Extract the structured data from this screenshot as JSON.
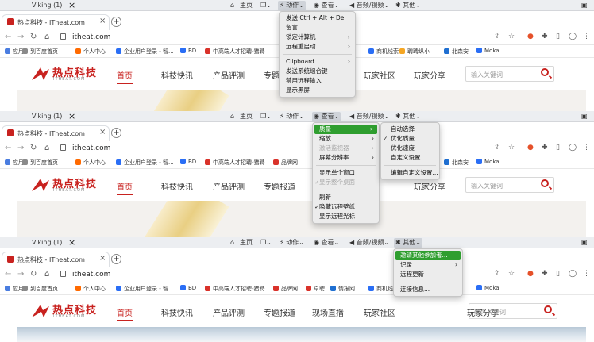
{
  "colors": {
    "accent": "#c8221f",
    "menu_highlight": "#2f9e2f",
    "traffic_red": "#ff5f57",
    "traffic_yellow": "#febc2e",
    "traffic_green": "#28c840"
  },
  "toolbar": {
    "title": "Viking (1)",
    "close_icon": "×",
    "home": "主页",
    "action": "动作",
    "view": "查看",
    "av": "音频/视频",
    "other": "其他"
  },
  "browser": {
    "tab_title": "热点科技 - ITheat.com",
    "tab_close": "×",
    "new_tab": "+",
    "url": "itheat.com"
  },
  "bookmarks": {
    "p1": [
      "应用",
      "到百度首页",
      "个人中心",
      "企业用户登录 - 智...",
      "BD",
      "中高端人才招聘-猎聘",
      "商机线索",
      "聘聘纵小",
      "北森安",
      "Moka"
    ],
    "p2": [
      "应用",
      "到百度首页",
      "个人中心",
      "企业用户登录 - 智...",
      "BD",
      "中高端人才招聘-猎聘",
      "品牌网",
      "北森安",
      "Moka"
    ],
    "p3": [
      "应用",
      "到百度首页",
      "个人中心",
      "企业用户登录 - 智...",
      "BD",
      "中高端人才招聘-猎聘",
      "品牌网",
      "卓聘",
      "情报网",
      "商机线索",
      "Moka"
    ]
  },
  "site": {
    "logo": "热点科技",
    "logo_sub": "ITHEAT.COM",
    "search_placeholder": "输入关键词",
    "nav": [
      "首页",
      "科技快讯",
      "产品评测",
      "专题报道",
      "现场直播",
      "玩家社区",
      "玩家分享"
    ]
  },
  "menus": {
    "action": {
      "items": [
        "发送 Ctrl + Alt + Del",
        "留言",
        "锁定计算机",
        "远程重启动",
        "Clipboard",
        "发送系统组合键",
        "禁用远程输入",
        "显示黑屏"
      ]
    },
    "view": {
      "items": [
        "质量",
        "缩放",
        "激活监视器",
        "屏幕分辨率",
        "显示单个窗口",
        "显示整个桌面",
        "刷新",
        "隐藏远程壁纸",
        "显示远程光标"
      ]
    },
    "quality": {
      "items": [
        "自动选择",
        "优化质量",
        "优化速度",
        "自定义设置",
        "编辑自定义设置..."
      ]
    },
    "other": {
      "items": [
        "邀请其他参加者...",
        "记录",
        "远程更新",
        "连接信息..."
      ]
    }
  }
}
